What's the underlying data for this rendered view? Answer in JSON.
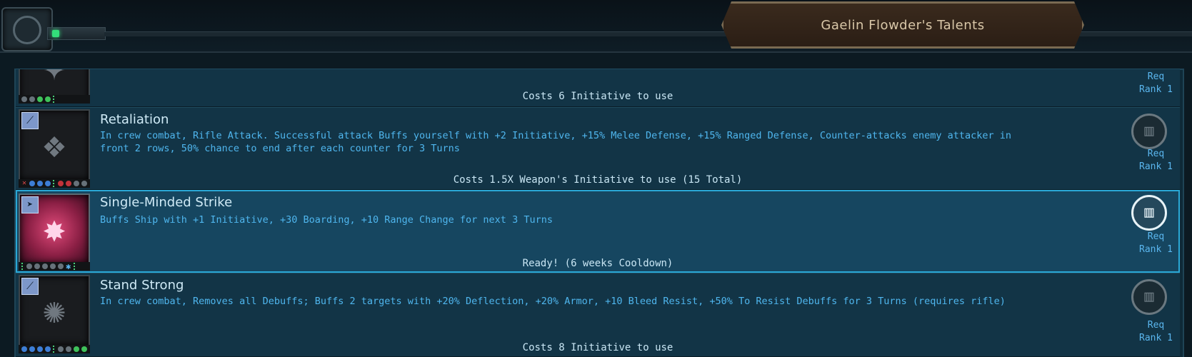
{
  "header": {
    "title": "Gaelin Flowder's Talents"
  },
  "talents": [
    {
      "name": "",
      "description": "",
      "cost": "Costs 6 Initiative to use",
      "req_label": "Req",
      "rank_label": "Rank 1",
      "icon": "partially-hidden-talent-icon"
    },
    {
      "name": "Retaliation",
      "description": "In crew combat, Rifle Attack. Successful attack Buffs yourself with +2 Initiative, +15% Melee Defense, +15% Ranged Defense, Counter-attacks enemy attacker in front 2 rows, 50% chance to end after each counter for 3 Turns",
      "cost": "Costs 1.5X Weapon's Initiative to use (15 Total)",
      "req_label": "Req",
      "rank_label": "Rank 1",
      "icon": "retaliation-icon"
    },
    {
      "name": "Single-Minded Strike",
      "description": "Buffs Ship with +1 Initiative, +30 Boarding, +10 Range Change for next 3 Turns",
      "cost": "Ready! (6 weeks Cooldown)",
      "req_label": "Req",
      "rank_label": "Rank 1",
      "icon": "single-minded-strike-icon"
    },
    {
      "name": "Stand Strong",
      "description": "In crew combat, Removes all Debuffs; Buffs 2 targets with +20% Deflection, +20% Armor, +10 Bleed Resist, +50% To Resist Debuffs for 3 Turns (requires rifle)",
      "cost": "Costs 8 Initiative to use",
      "req_label": "Req",
      "rank_label": "Rank 1",
      "icon": "stand-strong-icon"
    }
  ]
}
